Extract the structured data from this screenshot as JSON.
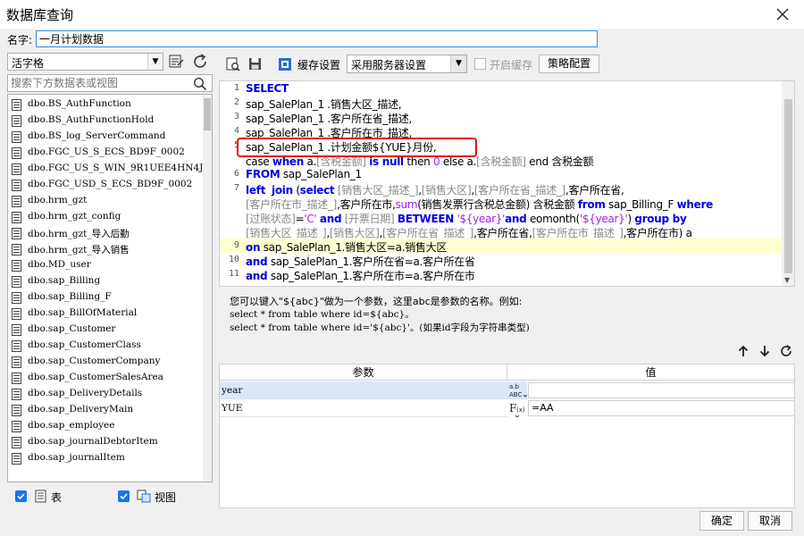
{
  "window": {
    "title": "数据库查询"
  },
  "name_field": {
    "label": "名字:",
    "value": "一月计划数据"
  },
  "left": {
    "font_combo": "活字格",
    "search_placeholder": "搜索下方数据表或视图",
    "items": [
      "dbo.BS_AuthFunction",
      "dbo.BS_AuthFunctionHold",
      "dbo.BS_log_ServerCommand",
      "dbo.FGC_US_S_ECS_BD9F_0002",
      "dbo.FGC_US_S_WIN_9R1UEE4HN4J",
      "dbo.FGC_USD_S_ECS_BD9F_0002",
      "dbo.hrm_gzt",
      "dbo.hrm_gzt_config",
      "dbo.hrm_gzt_导入后勤",
      "dbo.hrm_gzt_导入销售",
      "dbo.MD_user",
      "dbo.sap_Billing",
      "dbo.sap_Billing_F",
      "dbo.sap_BillOfMaterial",
      "dbo.sap_Customer",
      "dbo.sap_CustomerClass",
      "dbo.sap_CustomerCompany",
      "dbo.sap_CustomerSalesArea",
      "dbo.sap_DeliveryDetails",
      "dbo.sap_DeliveryMain",
      "dbo.sap_employee",
      "dbo.sap_journalDebtorItem",
      "dbo.sap_journalItem"
    ],
    "check_table": "表",
    "check_view": "视图"
  },
  "toolbar": {
    "cache_settings": "缓存设置",
    "cache_mode": "采用服务器设置",
    "enable_cache": "开启缓存",
    "strategy": "策略配置"
  },
  "editor": {
    "line_numbers": [
      "1",
      "2",
      "3",
      "4",
      "5",
      "",
      "6",
      "7",
      "",
      "",
      "9",
      "10",
      "11"
    ]
  },
  "hint": {
    "line1": "您可以键入\"${abc}\"做为一个参数，这里abc是参数的名称。例如:",
    "line2": "select * from table where id=${abc}。",
    "line3": "select * from table where id='${abc}'。(如果id字段为字符串类型)"
  },
  "params": {
    "col_param": "参数",
    "col_value": "值",
    "rows": [
      {
        "name": "year",
        "value": ""
      },
      {
        "name": "YUE",
        "value": "=AA"
      }
    ]
  },
  "footer": {
    "ok": "确定",
    "cancel": "取消"
  }
}
